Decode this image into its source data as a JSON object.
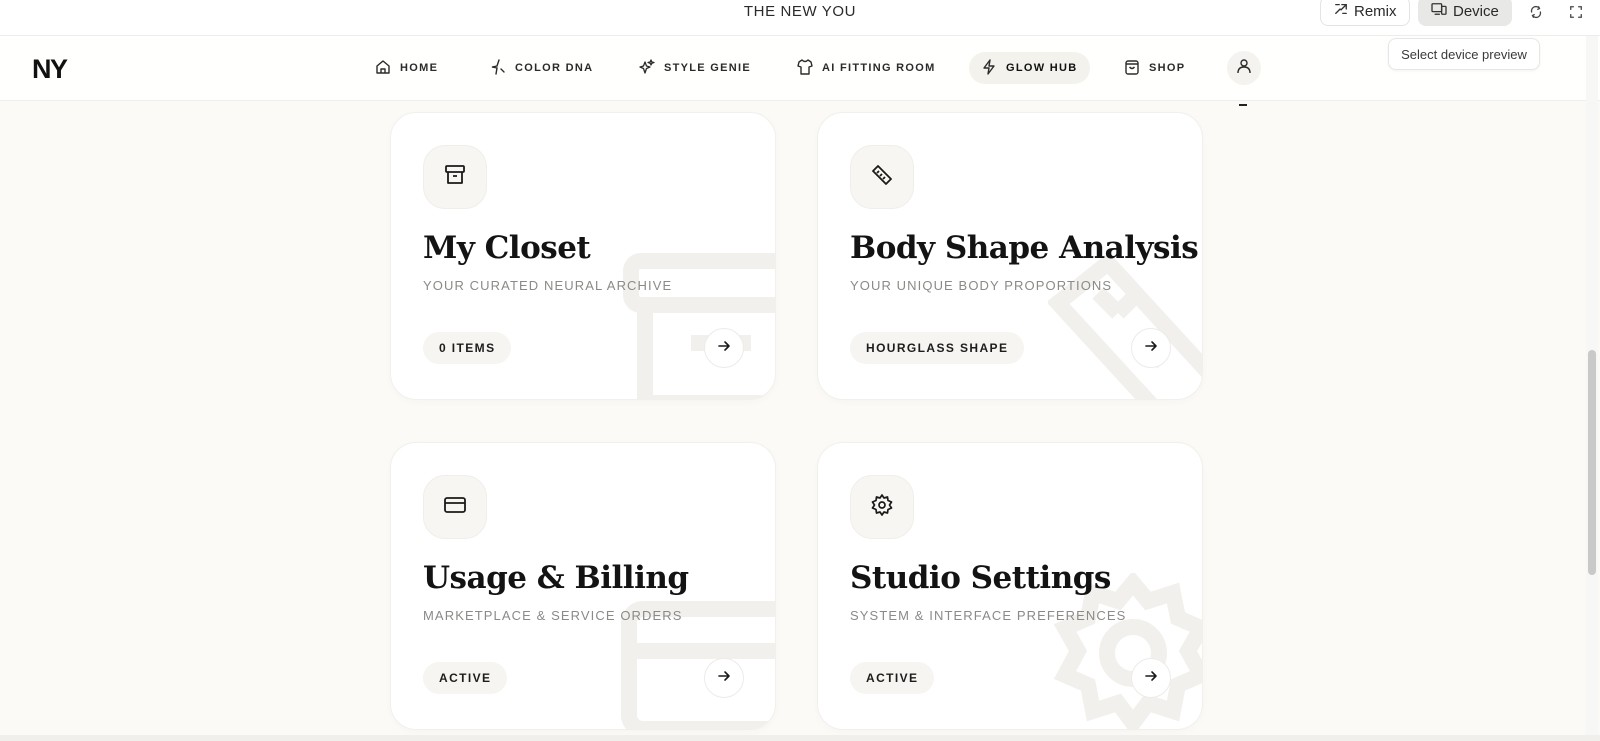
{
  "topbar": {
    "title": "THE NEW YOU",
    "remix_label": "Remix",
    "device_label": "Device",
    "tooltip": "Select device preview"
  },
  "nav": {
    "logo": "NY",
    "items": [
      {
        "label": "HOME",
        "icon": "home-icon"
      },
      {
        "label": "COLOR DNA",
        "icon": "sparkle-icon"
      },
      {
        "label": "STYLE GENIE",
        "icon": "stars-icon"
      },
      {
        "label": "AI FITTING ROOM",
        "icon": "shirt-icon"
      },
      {
        "label": "GLOW HUB",
        "icon": "lightning-icon",
        "active": true
      },
      {
        "label": "SHOP",
        "icon": "bag-icon"
      }
    ],
    "profile_icon": "user-icon"
  },
  "cards": [
    {
      "title": "My Closet",
      "subtitle": "YOUR CURATED NEURAL ARCHIVE",
      "badge": "0 ITEMS",
      "icon": "archive-icon"
    },
    {
      "title": "Body Shape Analysis",
      "subtitle": "YOUR UNIQUE BODY PROPORTIONS",
      "badge": "HOURGLASS SHAPE",
      "icon": "ruler-icon"
    },
    {
      "title": "Usage & Billing",
      "subtitle": "MARKETPLACE & SERVICE ORDERS",
      "badge": "ACTIVE",
      "icon": "credit-card-icon"
    },
    {
      "title": "Studio Settings",
      "subtitle": "SYSTEM & INTERFACE PREFERENCES",
      "badge": "ACTIVE",
      "icon": "gear-icon"
    }
  ],
  "colors": {
    "background": "#fbfaf6",
    "card": "#ffffff",
    "text": "#131313",
    "muted": "#8a8a86",
    "active_nav": "#f3f2ed"
  }
}
